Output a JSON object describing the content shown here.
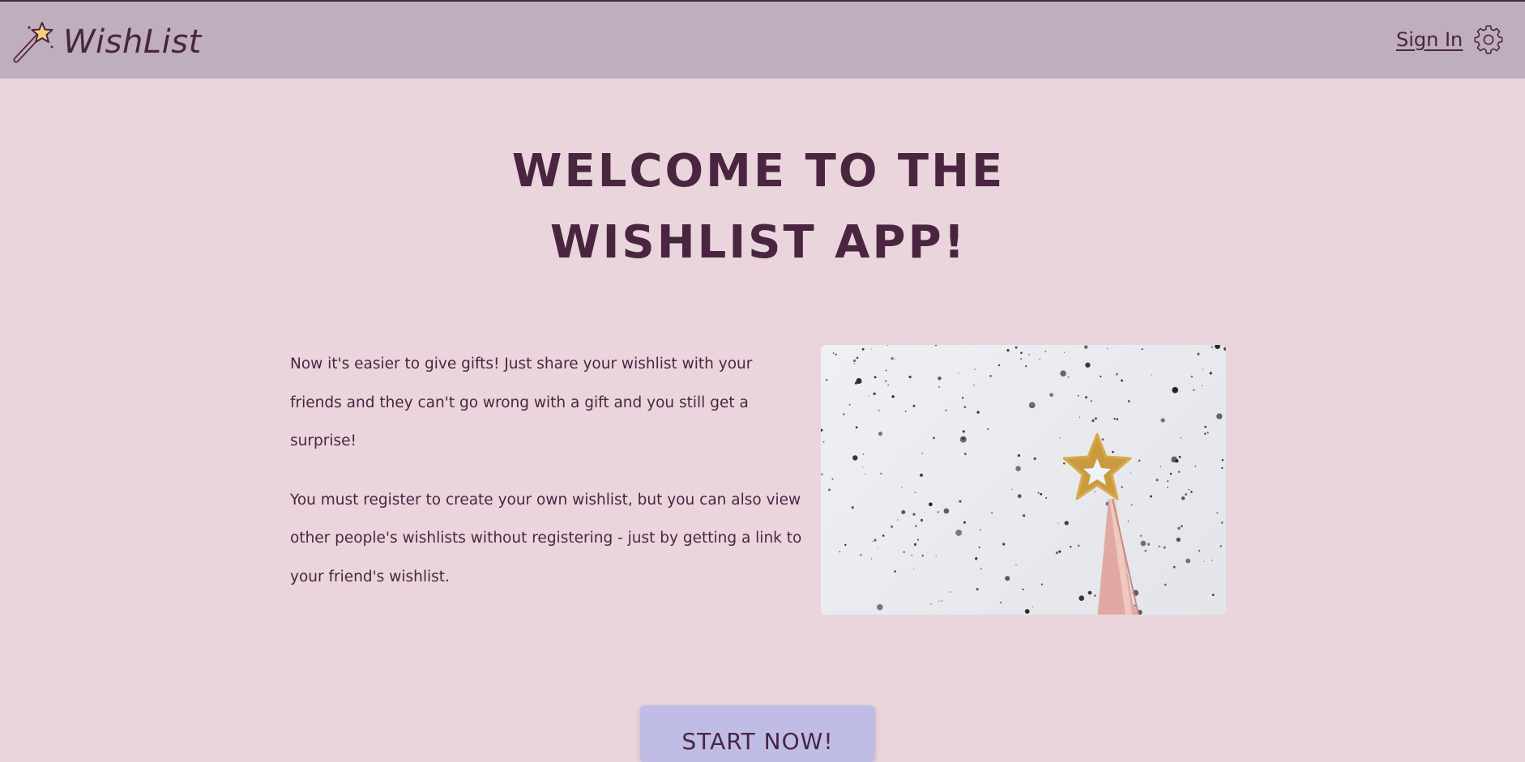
{
  "header": {
    "brand": "WishList",
    "signin_label": "Sign In",
    "brand_icon": "magic-wand-icon",
    "settings_icon": "gear-icon"
  },
  "hero": {
    "title_line1": "WELCOME TO THE",
    "title_line2": "WISHLIST APP!"
  },
  "intro": {
    "paragraph1": "Now it's easier to give gifts! Just share your wishlist with your friends and they can't go wrong with a gift and you still get a surprise!",
    "paragraph2": "You must register to create your own wishlist, but you can also view other people's wishlists without registering - just by getting a link to your friend's wishlist."
  },
  "cta": {
    "label": "START NOW!"
  },
  "colors": {
    "page_bg": "#ead5dd",
    "header_bg": "#bfaebb",
    "text": "#4a2540",
    "button_bg": "#bfbde6"
  }
}
